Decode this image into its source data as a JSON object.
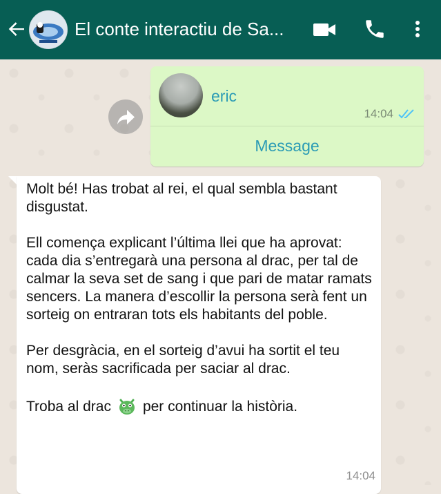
{
  "header": {
    "title": "El conte interactiu de Sa...",
    "back_icon": "arrow-left-icon",
    "video_icon": "video-camera-icon",
    "call_icon": "phone-icon",
    "menu_icon": "more-vertical-icon",
    "bg_color": "#075e54"
  },
  "messages": {
    "contact_card": {
      "name": "eric",
      "time": "14:04",
      "status": "read",
      "action_label": "Message",
      "bubble_color": "#dcf8c6",
      "accent_color": "#2a9bb5"
    },
    "incoming_text": {
      "paragraph1": "Molt bé! Has trobat al rei, el qual sembla bastant disgustat.",
      "paragraph2": "Ell comença explicant l’última llei que ha aprovat: cada dia s’entregarà una persona al drac, per tal de calmar la seva set de sang i que pari de matar ramats sencers. La manera d’escollir la persona serà fent un sorteig on entraran tots els habitants del poble.",
      "paragraph3": "Per desgràcia, en el sorteig d’avui ha sortit el teu nom, seràs sacrificada per saciar al drac.",
      "paragraph4_before": "Troba al drac",
      "emoji": "dragon-face-icon",
      "paragraph4_after": "per continuar la història.",
      "time": "14:04"
    }
  }
}
